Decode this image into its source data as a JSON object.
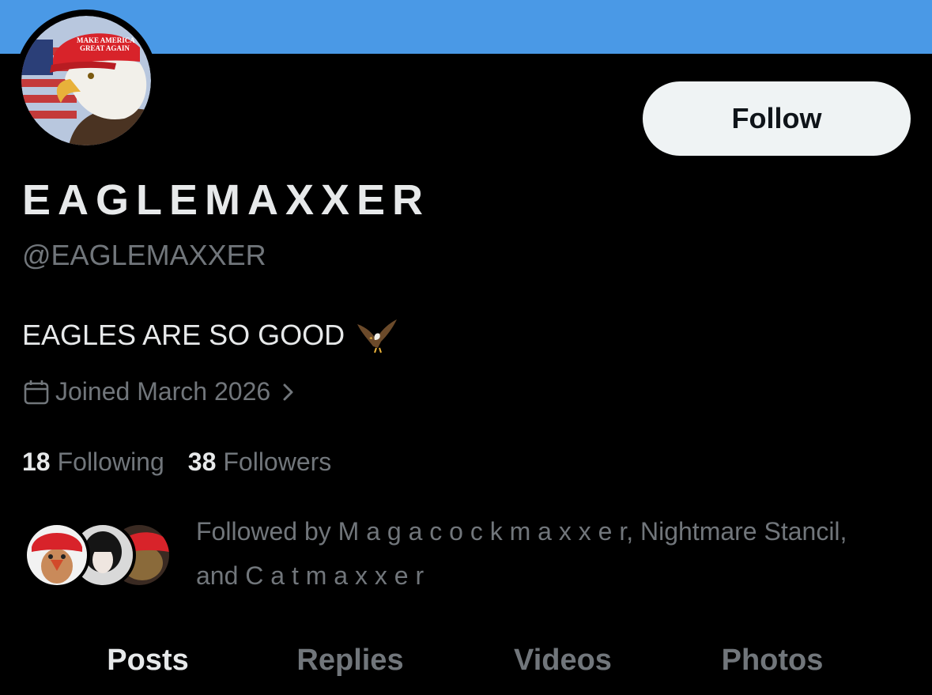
{
  "profile": {
    "display_name": "EAGLEMAXXER",
    "handle": "@EAGLEMAXXER",
    "bio": "EAGLES ARE SO GOOD",
    "joined": "Joined March 2026",
    "follow_label": "Follow",
    "avatar_hat_text": [
      "MAKE AMERICA",
      "GREAT AGAIN"
    ],
    "colors": {
      "banner": "#4a99e6",
      "background": "#000000",
      "primary_text": "#e7e9ea",
      "secondary_text": "#71767b",
      "follow_button_bg": "#eff3f4",
      "hat_red": "#d8232a"
    }
  },
  "stats": {
    "following_count": "18",
    "following_label": "Following",
    "followers_count": "38",
    "followers_label": "Followers"
  },
  "followed_by": {
    "line1": "Followed by M a g a c o c k m a x x e r, Nightmare Stancil,",
    "line2": "and C a  t m a  x  x  e  r"
  },
  "tabs": [
    {
      "label": "Posts",
      "active": true
    },
    {
      "label": "Replies",
      "active": false
    },
    {
      "label": "Videos",
      "active": false
    },
    {
      "label": "Photos",
      "active": false
    }
  ]
}
